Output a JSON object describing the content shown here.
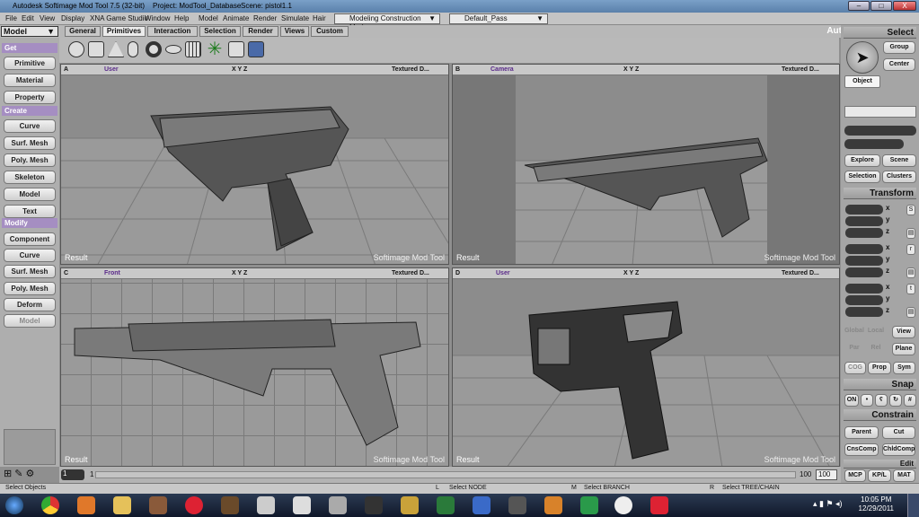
{
  "titlebar": {
    "app_title": "Autodesk Softimage Mod Tool 7.5 (32-bit)",
    "project": "Project: ModTool_Database",
    "scene": "Scene: pistol1.1",
    "btn_min": "–",
    "btn_max": "□",
    "btn_close": "X"
  },
  "menu": {
    "items": [
      "File",
      "Edit",
      "View",
      "Display",
      "XNA Game Studio",
      "Window",
      "Help",
      "Model",
      "Animate",
      "Render",
      "Simulate",
      "Hair"
    ],
    "construction_mode": "Modeling Construction Mode",
    "pass": "Default_Pass",
    "brand": "Autodesk Softimage"
  },
  "mode": {
    "selected": "Model"
  },
  "toolbar_tabs": [
    "General",
    "Primitives",
    "Interaction",
    "Selection",
    "Render",
    "Views",
    "Custom"
  ],
  "left_panel": {
    "get": "Get",
    "get_items": [
      "Primitive",
      "Material",
      "Property"
    ],
    "create": "Create",
    "create_items": [
      "Curve",
      "Surf. Mesh",
      "Poly. Mesh",
      "Skeleton",
      "Model",
      "Text"
    ],
    "modify": "Modify",
    "modify_items": [
      "Component",
      "Curve",
      "Surf. Mesh",
      "Poly. Mesh",
      "Deform",
      "Model"
    ]
  },
  "viewports": [
    {
      "letter": "A",
      "camera": "User",
      "axes": "X Y Z",
      "mode": "Textured D...",
      "result": "Result",
      "watermark": "Softimage Mod Tool"
    },
    {
      "letter": "B",
      "camera": "Camera",
      "axes": "X Y Z",
      "mode": "Textured D...",
      "result": "Result",
      "watermark": "Softimage Mod Tool"
    },
    {
      "letter": "C",
      "camera": "Front",
      "axes": "X Y Z",
      "mode": "Textured D...",
      "result": "Result",
      "watermark": "Softimage Mod Tool"
    },
    {
      "letter": "D",
      "camera": "User",
      "axes": "X Y Z",
      "mode": "Textured D...",
      "result": "Result",
      "watermark": "Softimage Mod Tool"
    }
  ],
  "right_panel": {
    "select": "Select",
    "group": "Group",
    "center": "Center",
    "object": "Object",
    "explore": "Explore",
    "scene": "Scene",
    "selection": "Selection",
    "clusters": "Clusters",
    "transform": "Transform",
    "axis_x": "x",
    "axis_y": "y",
    "axis_z": "z",
    "global": "Global",
    "local": "Local",
    "view": "View",
    "par": "Par",
    "rel": "Rel",
    "plane": "Plane",
    "cog": "COG",
    "prop": "Prop",
    "sym": "Sym",
    "snap": "Snap",
    "on": "ON",
    "constrain": "Constrain",
    "parent": "Parent",
    "cut": "Cut",
    "cnscomp": "CnsComp",
    "chldcomp": "ChldComp",
    "edit": "Edit",
    "mcp": "MCP",
    "kpl": "KP/L",
    "mat": "MAT"
  },
  "timeline": {
    "start": "1",
    "field": "1",
    "end": "100",
    "end_field": "100"
  },
  "status": {
    "left": "Select Objects",
    "l_key": "L",
    "l_text": "Select NODE",
    "m_key": "M",
    "m_text": "Select BRANCH",
    "r_key": "R",
    "r_text": "Select TREE/CHAIN"
  },
  "taskbar": {
    "time": "10:05 PM",
    "date": "12/29/2011"
  }
}
